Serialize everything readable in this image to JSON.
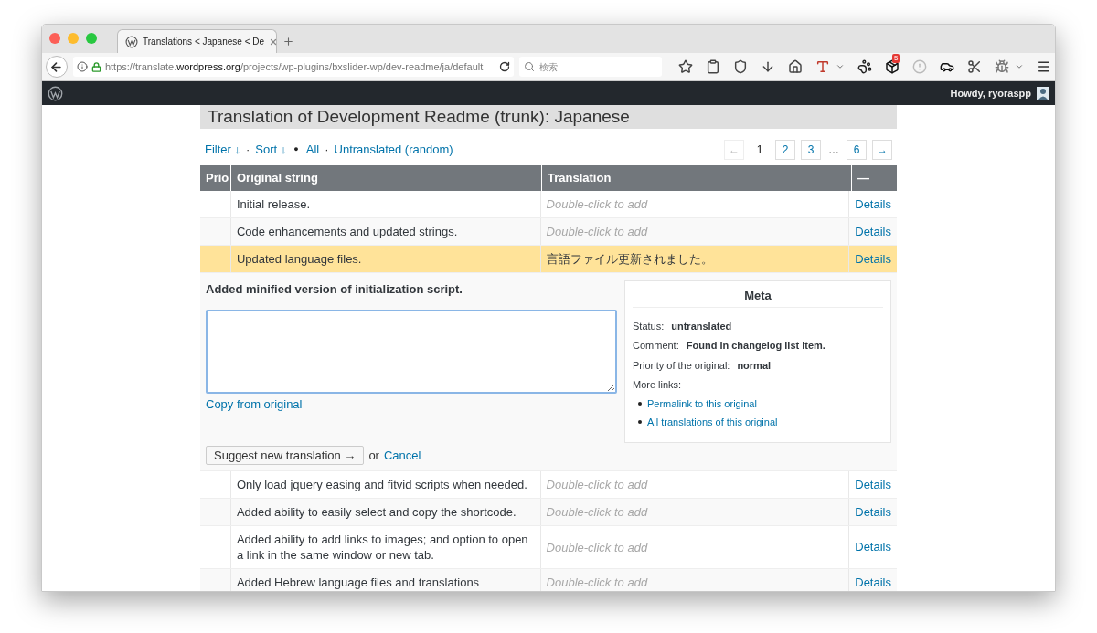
{
  "browser": {
    "tab_title": "Translations < Japanese < De",
    "url": {
      "before": "https://translate.",
      "domain": "wordpress.org",
      "after": "/projects/wp-plugins/bxslider-wp/dev-readme/ja/default"
    },
    "search": {
      "placeholder": "検索"
    },
    "badge": "5"
  },
  "admin_bar": {
    "greeting": "Howdy, ryoraspp"
  },
  "title": "Translation of Development Readme (trunk): Japanese",
  "filters": [
    {
      "kind": "link",
      "label": "Filter ↓"
    },
    {
      "kind": "sep",
      "label": "·"
    },
    {
      "kind": "link",
      "label": "Sort ↓"
    },
    {
      "kind": "bullet",
      "label": "●"
    },
    {
      "kind": "link",
      "label": "All"
    },
    {
      "kind": "sep",
      "label": "·"
    },
    {
      "kind": "link",
      "label": "Untranslated (random)"
    }
  ],
  "pagination": [
    {
      "kind": "arrow",
      "label": "←",
      "disabled": true
    },
    {
      "kind": "page",
      "label": "1",
      "selected": true
    },
    {
      "kind": "page",
      "label": "2",
      "selected": false
    },
    {
      "kind": "page",
      "label": "3",
      "selected": false
    },
    {
      "kind": "gap",
      "label": "…"
    },
    {
      "kind": "page",
      "label": "6",
      "selected": false
    },
    {
      "kind": "arrow",
      "label": "→",
      "disabled": false
    }
  ],
  "table": {
    "columns": [
      "Prio",
      "Original string",
      "Translation",
      "—"
    ],
    "rows": [
      {
        "kind": "row",
        "original": "Initial release.",
        "translation": "Double-click to add",
        "translated": false,
        "selected": false,
        "details": "Details"
      },
      {
        "kind": "row",
        "original": "Code enhancements and updated strings.",
        "translation": "Double-click to add",
        "translated": false,
        "selected": false,
        "details": "Details"
      },
      {
        "kind": "row",
        "original": "Updated language files.",
        "translation": "言語ファイル更新されました。",
        "translated": true,
        "selected": true,
        "details": "Details"
      },
      {
        "kind": "editor",
        "original": "Added minified version of initialization script.",
        "copy_link": "Copy from original",
        "suggest_button": "Suggest new translation →",
        "or": "or",
        "cancel": "Cancel",
        "meta": {
          "title": "Meta",
          "fields": [
            {
              "label": "Status:",
              "value": "untranslated"
            },
            {
              "label": "Comment:",
              "value": "Found in changelog list item."
            },
            {
              "label": "Priority of the original:",
              "value": "normal"
            }
          ],
          "more_links": "More links:",
          "links": [
            "Permalink to this original",
            "All translations of this original"
          ]
        }
      },
      {
        "kind": "row",
        "original": "Only load jquery easing and fitvid scripts when needed.",
        "translation": "Double-click to add",
        "translated": false,
        "selected": false,
        "details": "Details"
      },
      {
        "kind": "row",
        "original": "Added ability to easily select and copy the shortcode.",
        "translation": "Double-click to add",
        "translated": false,
        "selected": false,
        "details": "Details"
      },
      {
        "kind": "row",
        "original": "Added ability to add links to images; and option to open a link in the same window or new tab.",
        "translation": "Double-click to add",
        "translated": false,
        "selected": false,
        "details": "Details"
      },
      {
        "kind": "row",
        "original": "Added Hebrew language files and translations",
        "translation": "Double-click to add",
        "translated": false,
        "selected": false,
        "details": "Details"
      }
    ]
  }
}
